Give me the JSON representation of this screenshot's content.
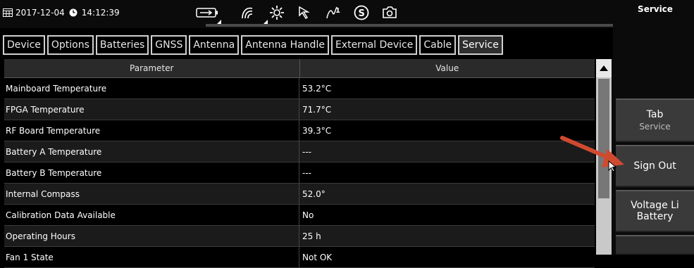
{
  "status_bar": {
    "date": "2017-12-04",
    "time": "14:12:39",
    "icons": [
      "calendar-icon",
      "clock-icon",
      "battery-icon",
      "signal-icon",
      "gear-icon",
      "cursor-mode-icon",
      "marker-icon",
      "s-circle-icon",
      "camera-icon"
    ]
  },
  "tabs": [
    {
      "label": "Device"
    },
    {
      "label": "Options"
    },
    {
      "label": "Batteries"
    },
    {
      "label": "GNSS"
    },
    {
      "label": "Antenna"
    },
    {
      "label": "Antenna Handle"
    },
    {
      "label": "External Device"
    },
    {
      "label": "Cable"
    },
    {
      "label": "Service",
      "active": true
    }
  ],
  "table": {
    "headers": {
      "parameter": "Parameter",
      "value": "Value"
    },
    "rows": [
      {
        "parameter": "Mainboard Temperature",
        "value": "53.2°C"
      },
      {
        "parameter": "FPGA Temperature",
        "value": "71.7°C"
      },
      {
        "parameter": "RF Board Temperature",
        "value": "39.3°C"
      },
      {
        "parameter": "Battery A Temperature",
        "value": "---"
      },
      {
        "parameter": "Battery B Temperature",
        "value": "---"
      },
      {
        "parameter": "Internal Compass",
        "value": "52.0°"
      },
      {
        "parameter": "Calibration Data Available",
        "value": "No"
      },
      {
        "parameter": "Operating Hours",
        "value": "25 h"
      },
      {
        "parameter": "Fan 1 State",
        "value": "Not OK"
      }
    ]
  },
  "right_panel": {
    "title": "Service",
    "softkeys": [
      {
        "label": "Tab",
        "sub": "Service"
      },
      {
        "label": "Sign Out",
        "sub": ""
      },
      {
        "label": "Voltage Li",
        "sub": "Battery"
      }
    ]
  },
  "colors": {
    "background": "#000000",
    "annotation_arrow": "#d04a2f"
  }
}
